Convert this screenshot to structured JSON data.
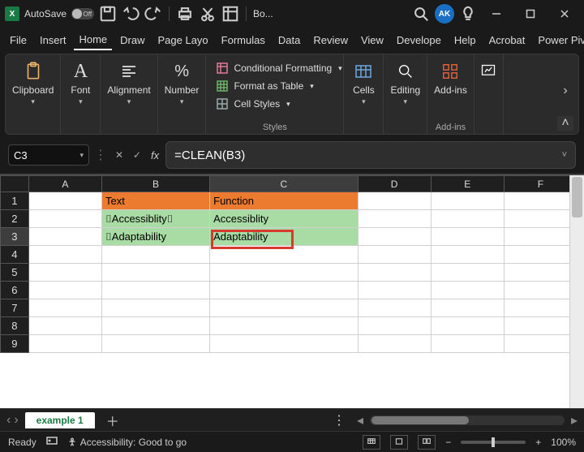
{
  "titlebar": {
    "autosave_label": "AutoSave",
    "autosave_state": "Off",
    "doc_title": "Bo...",
    "avatar_initials": "AK"
  },
  "menu": {
    "tabs": [
      "File",
      "Insert",
      "Home",
      "Draw",
      "Page Layo",
      "Formulas",
      "Data",
      "Review",
      "View",
      "Develope",
      "Help",
      "Acrobat",
      "Power Piv"
    ],
    "active_index": 2
  },
  "ribbon": {
    "groups": {
      "clipboard": "Clipboard",
      "font": "Font",
      "alignment": "Alignment",
      "number": "Number",
      "cells": "Cells",
      "editing": "Editing",
      "addins": "Add-ins"
    },
    "styles": {
      "cond_fmt": "Conditional Formatting",
      "fmt_table": "Format as Table",
      "cell_styles": "Cell Styles",
      "group_label": "Styles"
    },
    "addins_label": "Add-ins"
  },
  "formula": {
    "namebox": "C3",
    "fx": "fx",
    "value": "=CLEAN(B3)"
  },
  "grid": {
    "columns": [
      "A",
      "B",
      "C",
      "D",
      "E",
      "F"
    ],
    "rows": [
      {
        "r": "1",
        "B": "Text",
        "C": "Function",
        "cls": "orange"
      },
      {
        "r": "2",
        "B": "␣Accessiblity␣",
        "C": "Accessiblity",
        "cls": "green"
      },
      {
        "r": "3",
        "B": "␣Adaptability",
        "C": "Adaptability",
        "cls": "green",
        "selected": true
      },
      {
        "r": "4"
      },
      {
        "r": "5"
      },
      {
        "r": "6"
      },
      {
        "r": "7"
      },
      {
        "r": "8"
      },
      {
        "r": "9"
      }
    ],
    "selected_col": "C",
    "selected_row": "3"
  },
  "sheet": {
    "active": "example 1"
  },
  "status": {
    "state": "Ready",
    "accessibility": "Accessibility: Good to go",
    "zoom": "100%"
  }
}
